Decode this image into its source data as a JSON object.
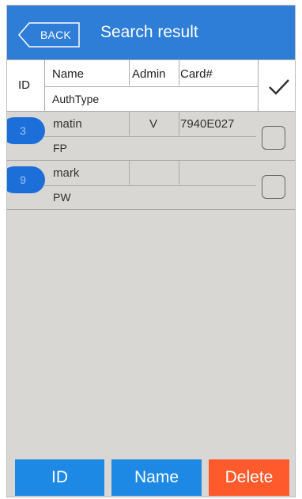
{
  "header": {
    "back_label": "BACK",
    "title": "Search result"
  },
  "columns": {
    "id": "ID",
    "name": "Name",
    "admin": "Admin",
    "card": "Card#",
    "auth_type": "AuthType"
  },
  "rows": [
    {
      "id": "3",
      "name": "matin",
      "admin": "V",
      "card": "7940E027",
      "auth_type": "FP",
      "checked": false
    },
    {
      "id": "9",
      "name": "mark",
      "admin": "",
      "card": "",
      "auth_type": "PW",
      "checked": false
    }
  ],
  "buttons": {
    "id": "ID",
    "name": "Name",
    "delete": "Delete"
  },
  "colors": {
    "header": "#2e7dd6",
    "id_button": "#1e88e5",
    "name_button": "#1e88e5",
    "delete_button": "#ff5a2b",
    "pill": "#1c6fd9"
  },
  "icons": {
    "select_all": "check-icon",
    "back": "back-arrow-icon"
  }
}
